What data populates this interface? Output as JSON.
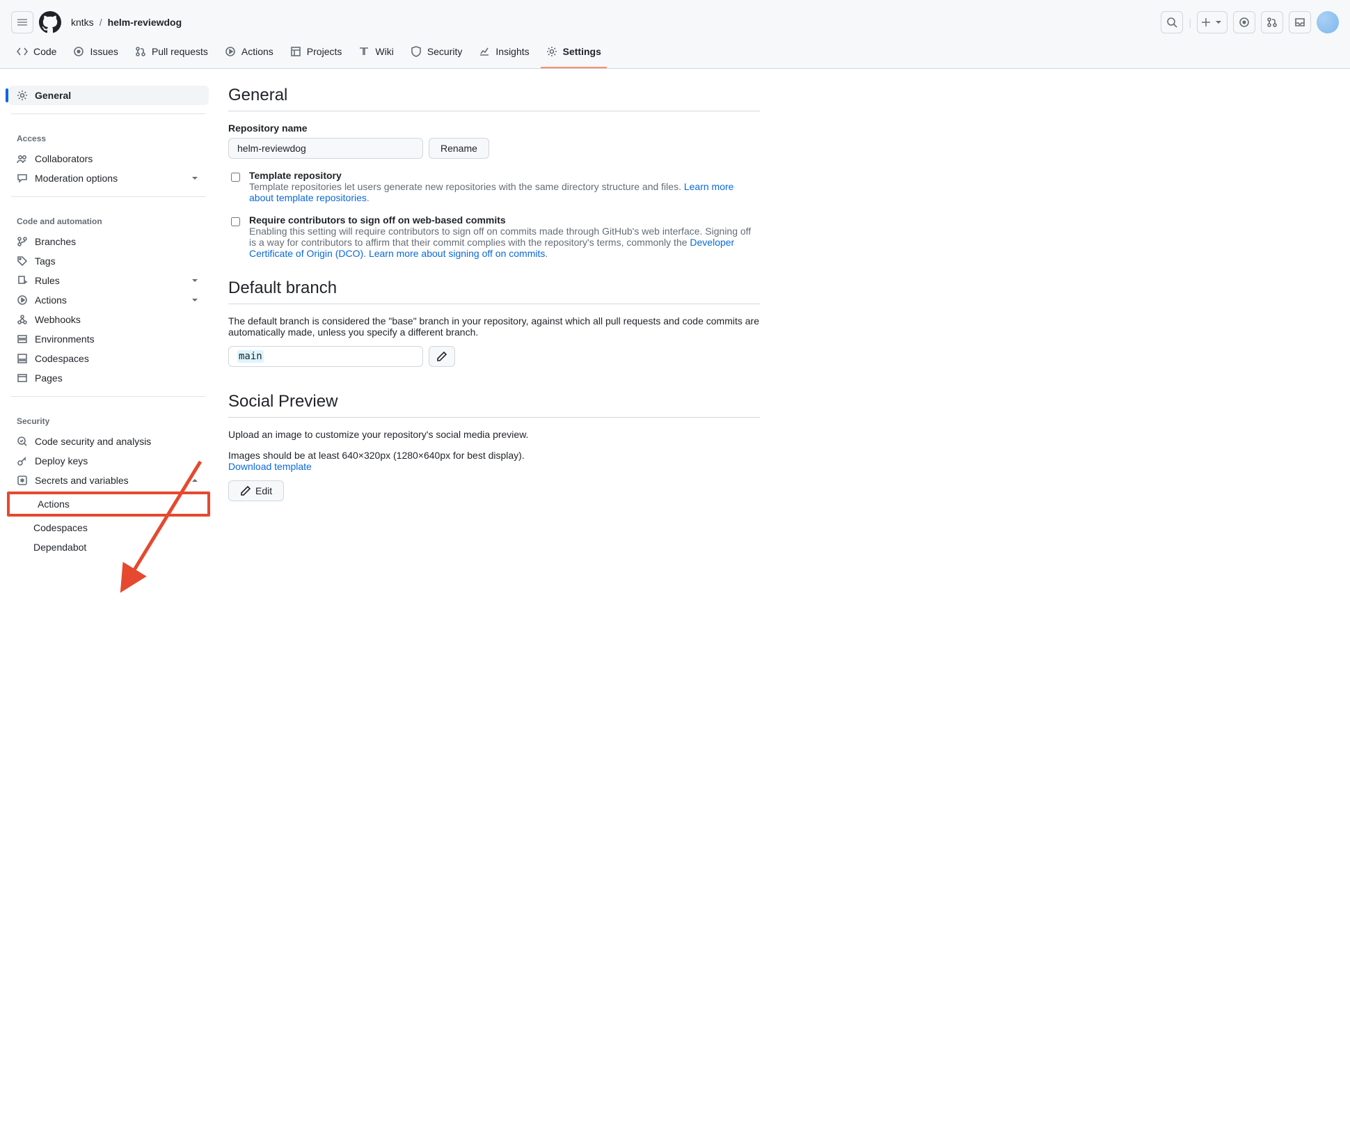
{
  "header": {
    "owner": "kntks",
    "separator": "/",
    "repo": "helm-reviewdog"
  },
  "repo_tabs": [
    {
      "label": "Code"
    },
    {
      "label": "Issues"
    },
    {
      "label": "Pull requests"
    },
    {
      "label": "Actions"
    },
    {
      "label": "Projects"
    },
    {
      "label": "Wiki"
    },
    {
      "label": "Security"
    },
    {
      "label": "Insights"
    },
    {
      "label": "Settings"
    }
  ],
  "sidebar": {
    "general": "General",
    "group_access": "Access",
    "collaborators": "Collaborators",
    "moderation": "Moderation options",
    "group_code": "Code and automation",
    "branches": "Branches",
    "tags": "Tags",
    "rules": "Rules",
    "actions": "Actions",
    "webhooks": "Webhooks",
    "environments": "Environments",
    "codespaces": "Codespaces",
    "pages": "Pages",
    "group_security": "Security",
    "code_security": "Code security and analysis",
    "deploy_keys": "Deploy keys",
    "secrets": "Secrets and variables",
    "sub_actions": "Actions",
    "sub_codespaces": "Codespaces",
    "sub_dependabot": "Dependabot"
  },
  "main": {
    "general_heading": "General",
    "repo_name_label": "Repository name",
    "repo_name_value": "helm-reviewdog",
    "rename_btn": "Rename",
    "template_title": "Template repository",
    "template_desc_pre": "Template repositories let users generate new repositories with the same directory structure and files. ",
    "template_link": "Learn more about template repositories",
    "signoff_title": "Require contributors to sign off on web-based commits",
    "signoff_desc_pre": "Enabling this setting will require contributors to sign off on commits made through GitHub's web interface. Signing off is a way for contributors to affirm that their commit complies with the repository's terms, commonly the ",
    "signoff_link1": "Developer Certificate of Origin (DCO)",
    "signoff_mid": ". ",
    "signoff_link2": "Learn more about signing off on commits",
    "default_branch_heading": "Default branch",
    "default_branch_desc": "The default branch is considered the \"base\" branch in your repository, against which all pull requests and code commits are automatically made, unless you specify a different branch.",
    "default_branch_value": "main",
    "social_heading": "Social Preview",
    "social_desc1": "Upload an image to customize your repository's social media preview.",
    "social_desc2": "Images should be at least 640×320px (1280×640px for best display).",
    "social_link": "Download template",
    "edit_btn": "Edit"
  }
}
